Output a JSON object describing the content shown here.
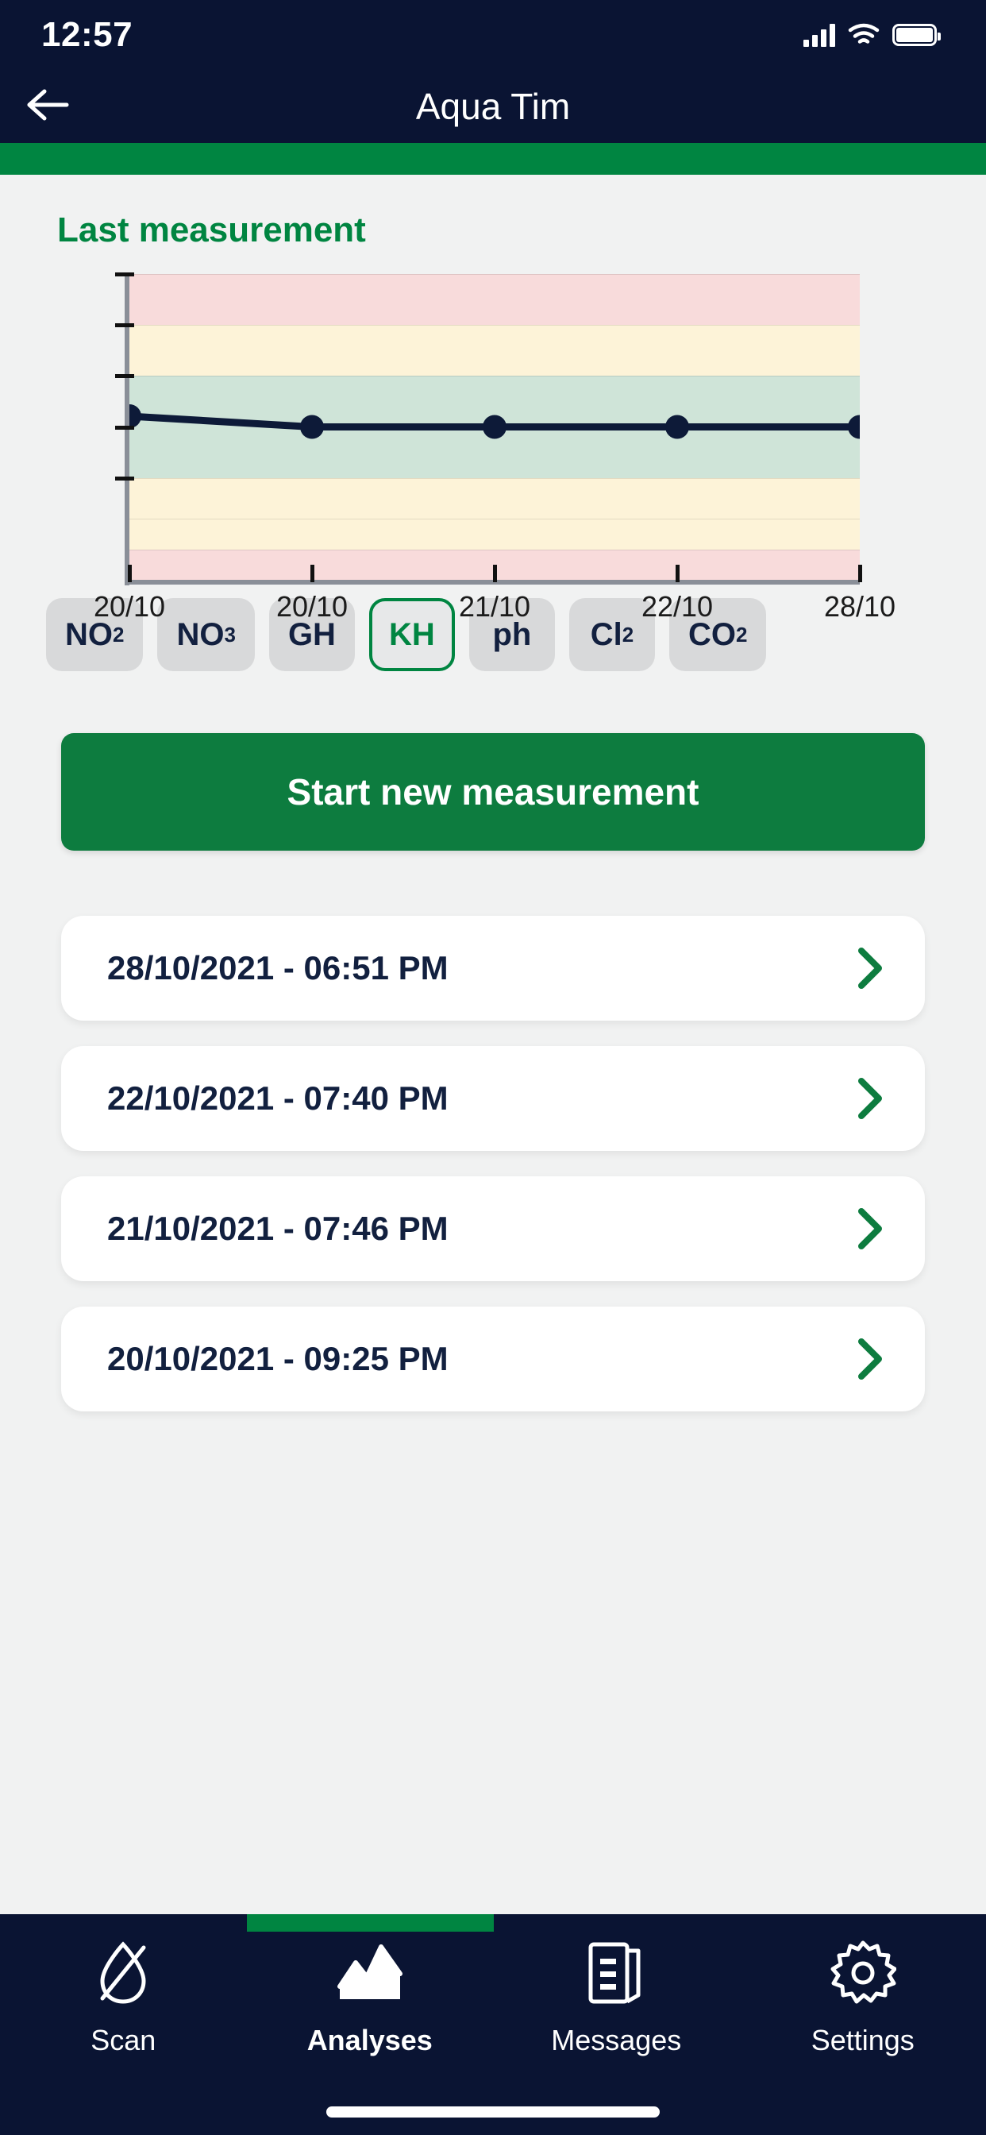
{
  "status_bar": {
    "time": "12:57",
    "signal_icon": "cellular-signal-icon",
    "wifi_icon": "wifi-icon",
    "battery_icon": "battery-icon"
  },
  "nav": {
    "back_icon": "back-arrow-icon",
    "title": "Aqua Tim"
  },
  "main": {
    "section_title": "Last measurement",
    "primary_button": "Start new measurement"
  },
  "chart_data": {
    "type": "line",
    "title": "Last measurement",
    "xlabel": "",
    "ylabel": "",
    "grid": false,
    "legend": false,
    "x": [
      "20/10",
      "20/10",
      "21/10",
      "22/10",
      "28/10"
    ],
    "categories": [
      "20/10",
      "20/10",
      "21/10",
      "22/10",
      "28/10"
    ],
    "series": [
      {
        "name": "KH",
        "values": [
          5.35,
          5.0,
          5.0,
          5.0,
          5.0
        ]
      }
    ],
    "ylim": [
      0,
      10
    ],
    "yticks": [
      10,
      8.33,
      6.67,
      5.0,
      3.33
    ],
    "line_color": "#0d1a38",
    "point_color": "#0d1a38",
    "bands": [
      {
        "label": "high-critical",
        "from": 8.33,
        "to": 10.0,
        "color": "#f8dbdb"
      },
      {
        "label": "high-warning",
        "from": 6.67,
        "to": 8.33,
        "color": "#fdf3d8"
      },
      {
        "label": "optimal",
        "from": 3.33,
        "to": 6.67,
        "color": "#cfe4d8"
      },
      {
        "label": "low-warning-a",
        "from": 2.0,
        "to": 3.33,
        "color": "#fdf3d8"
      },
      {
        "label": "low-warning-b",
        "from": 1.0,
        "to": 2.0,
        "color": "#fdf3d8"
      },
      {
        "label": "low-critical",
        "from": 0.0,
        "to": 1.0,
        "color": "#f8dbdb"
      }
    ]
  },
  "parameter_chips": [
    {
      "label": "NO",
      "sub": "2",
      "selected": false
    },
    {
      "label": "NO",
      "sub": "3",
      "selected": false
    },
    {
      "label": "GH",
      "sub": "",
      "selected": false
    },
    {
      "label": "KH",
      "sub": "",
      "selected": true
    },
    {
      "label": "ph",
      "sub": "",
      "selected": false
    },
    {
      "label": "Cl",
      "sub": "2",
      "selected": false
    },
    {
      "label": "CO",
      "sub": "2",
      "selected": false
    }
  ],
  "measurements": [
    {
      "label": "28/10/2021 - 06:51 PM",
      "chevron_icon": "chevron-right-icon"
    },
    {
      "label": "22/10/2021 - 07:40 PM",
      "chevron_icon": "chevron-right-icon"
    },
    {
      "label": "21/10/2021 - 07:46 PM",
      "chevron_icon": "chevron-right-icon"
    },
    {
      "label": "20/10/2021 - 09:25 PM",
      "chevron_icon": "chevron-right-icon"
    }
  ],
  "tab_bar": {
    "items": [
      {
        "label": "Scan",
        "icon": "water-drop-scan-icon",
        "active": false
      },
      {
        "label": "Analyses",
        "icon": "chart-mountain-icon",
        "active": true
      },
      {
        "label": "Messages",
        "icon": "document-list-icon",
        "active": false
      },
      {
        "label": "Settings",
        "icon": "gear-icon",
        "active": false
      }
    ]
  },
  "colors": {
    "navy": "#0a1433",
    "green": "#008541",
    "button_green": "#0d7c3f",
    "page_bg": "#f1f2f2",
    "card_bg": "#ffffff"
  }
}
